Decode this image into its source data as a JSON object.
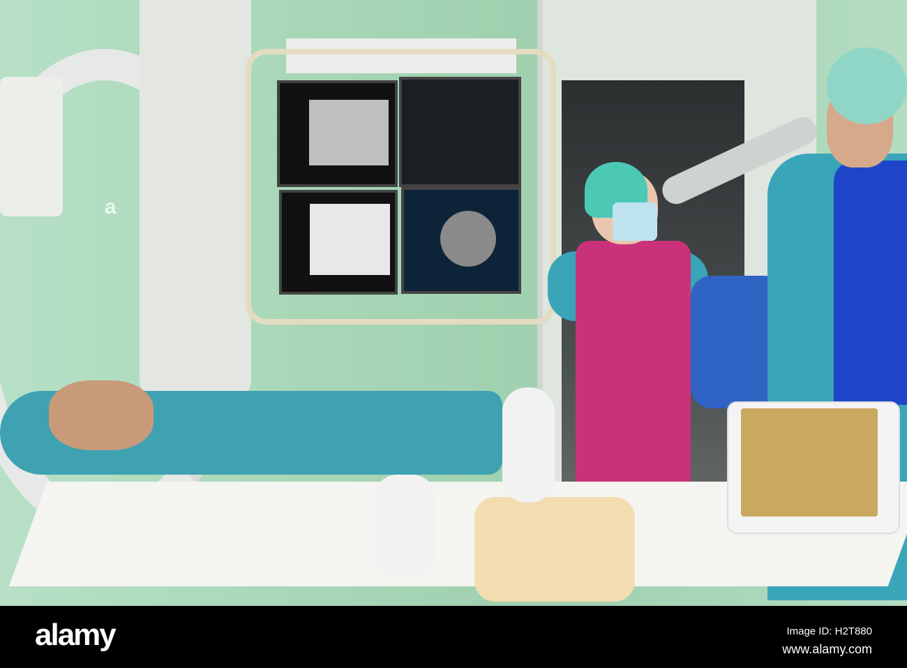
{
  "watermark": {
    "logo": "alamy",
    "image_id": "Image ID: H2T880",
    "url": "www.alamy.com"
  },
  "colors": {
    "wall": "#a9d6b6",
    "scrubs": "#3aa5b8",
    "apron": "#c9327a",
    "vest": "#1f45c9",
    "bar": "#000000"
  }
}
